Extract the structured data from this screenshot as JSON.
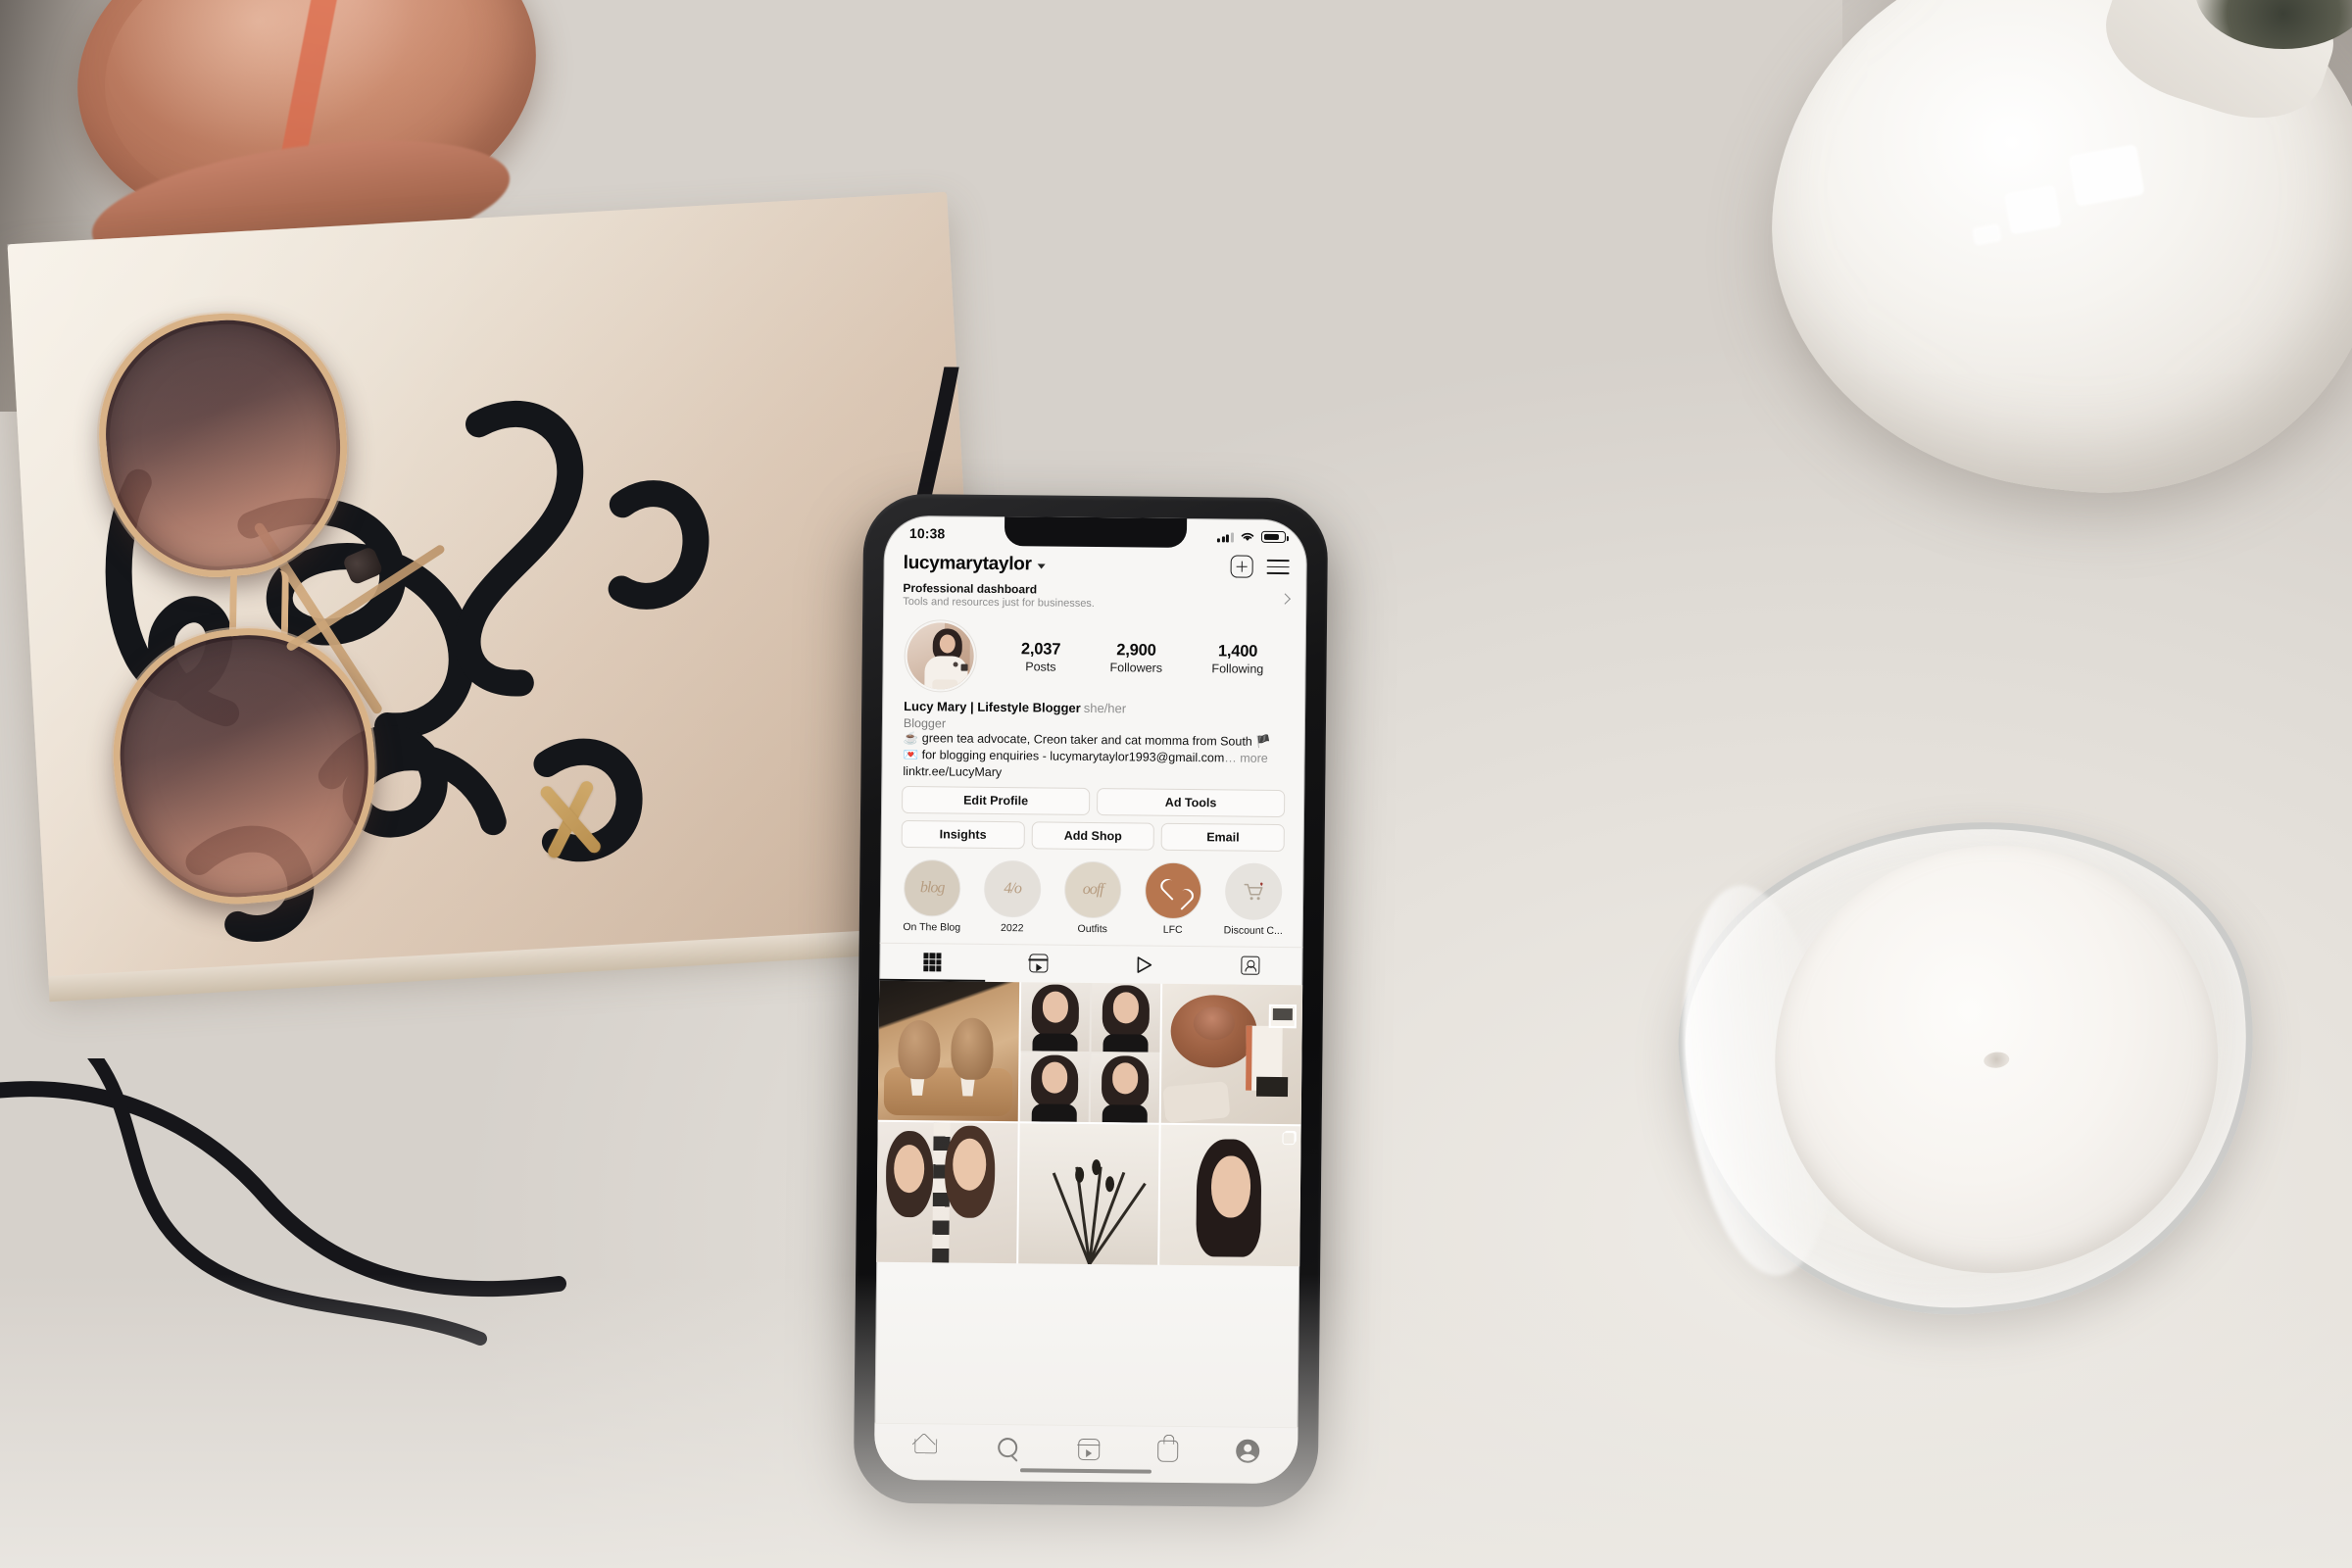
{
  "scene": {
    "description": "Flat-lay photo of an iPhone in a black case displaying an Instagram profile, resting on a cream style book with sunglasses, beside a white vase, copper dish and a candle",
    "objects": [
      {
        "name": "copper-dish",
        "label": "Copper dish"
      },
      {
        "name": "style-book",
        "label": "Style book"
      },
      {
        "name": "sunglasses",
        "label": "Sunglasses"
      },
      {
        "name": "white-vase",
        "label": "White ceramic vase"
      },
      {
        "name": "candle-jar",
        "label": "White candle in glass jar"
      },
      {
        "name": "black-cord",
        "label": "Black cord"
      }
    ]
  },
  "phone": {
    "status_bar": {
      "time": "10:38",
      "signal_icon": "cellular-signal-icon",
      "wifi_icon": "wifi-icon",
      "battery_icon": "battery-icon"
    }
  },
  "instagram": {
    "header": {
      "username": "lucymarytaylor",
      "dropdown_icon": "chevron-down-icon",
      "add_icon": "plus-square-icon",
      "menu_icon": "hamburger-menu-icon"
    },
    "professional_dashboard": {
      "title": "Professional dashboard",
      "subtitle": "Tools and resources just for businesses.",
      "chevron_icon": "chevron-right-icon"
    },
    "stats": [
      {
        "number": "2,037",
        "label": "Posts"
      },
      {
        "number": "2,900",
        "label": "Followers"
      },
      {
        "number": "1,400",
        "label": "Following"
      }
    ],
    "bio": {
      "display_name": "Lucy Mary | Lifestyle Blogger",
      "pronouns": "she/her",
      "category": "Blogger",
      "line1": "☕ green tea advocate, Creon taker and cat momma from South 🏴󠁧󠁢󠁷󠁬󠁳",
      "line2": "💌 for blogging enquiries - lucymarytaylor1993@gmail.com",
      "more": "… more",
      "link": "linktr.ee/LucyMary"
    },
    "action_buttons_row1": [
      "Edit Profile",
      "Ad Tools"
    ],
    "action_buttons_row2": [
      "Insights",
      "Add Shop",
      "Email"
    ],
    "highlights": [
      {
        "label": "On The Blog",
        "icon": "script-blog-icon",
        "color": "#d6cdbf"
      },
      {
        "label": "2022",
        "icon": "script-year-icon",
        "color": "#e4e0da"
      },
      {
        "label": "Outfits",
        "icon": "script-outfits-icon",
        "color": "#ded6c8"
      },
      {
        "label": "LFC",
        "icon": "heart-icon",
        "color": "#b7764f"
      },
      {
        "label": "Discount C...",
        "icon": "shopping-cart-icon",
        "color": "#e6e3de"
      }
    ],
    "tabs": [
      {
        "name": "grid",
        "icon": "grid-icon",
        "active": true
      },
      {
        "name": "reels",
        "icon": "reels-icon",
        "active": false
      },
      {
        "name": "igtv",
        "icon": "play-icon",
        "active": false
      },
      {
        "name": "tagged",
        "icon": "tagged-person-icon",
        "active": false
      }
    ],
    "posts": [
      {
        "name": "post-ice-cream",
        "alt": "Two swirled desserts on a wooden board"
      },
      {
        "name": "post-selfie-grid",
        "alt": "Four-up selfie collage"
      },
      {
        "name": "post-hat-flatlay",
        "alt": "Copper felt hat flat-lay with polaroids"
      },
      {
        "name": "post-two-women",
        "alt": "Two women smiling selfie"
      },
      {
        "name": "post-plant",
        "alt": "Dried plant arrangement"
      },
      {
        "name": "post-portrait",
        "alt": "Dark-haired portrait",
        "carousel": true
      }
    ],
    "bottom_nav": [
      {
        "name": "home",
        "icon": "home-icon",
        "active": false
      },
      {
        "name": "search",
        "icon": "search-icon",
        "active": false
      },
      {
        "name": "reels",
        "icon": "reels-icon",
        "active": false
      },
      {
        "name": "shop",
        "icon": "shop-bag-icon",
        "active": false
      },
      {
        "name": "profile",
        "icon": "profile-avatar-icon",
        "active": true
      }
    ]
  },
  "colors": {
    "accent_terracotta": "#b7764f",
    "phone_case": "#141415",
    "screen_bg": "#f7f6f4",
    "table": "#e6e2dc",
    "book": "#ddc9b6",
    "copper": "#b5745a"
  }
}
